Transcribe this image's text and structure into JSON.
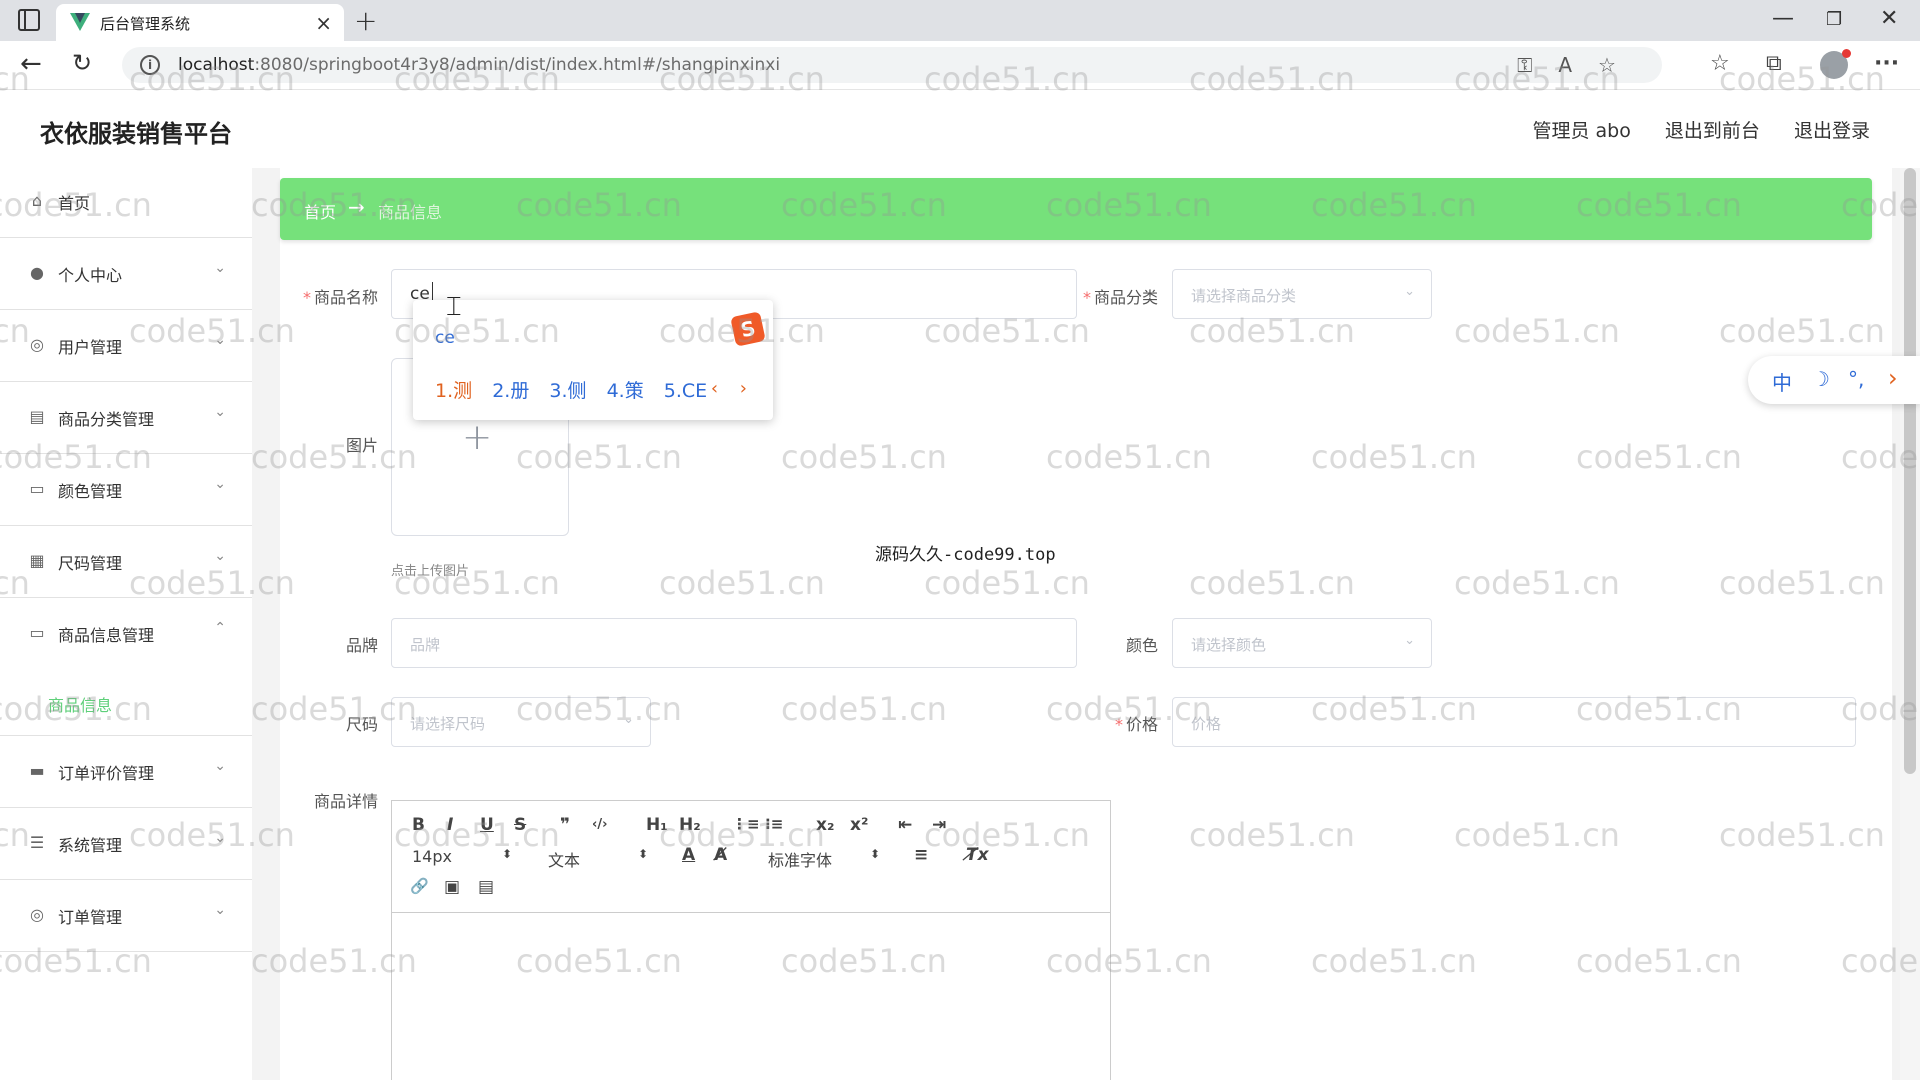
{
  "browser": {
    "tab_title": "后台管理系统",
    "tab_close": "×",
    "new_tab": "+",
    "address_host": "localhost",
    "address_path": ":8080/springboot4r3y8/admin/dist/index.html#/shangpinxinxi",
    "window_controls": [
      "—",
      "❐",
      "✕"
    ]
  },
  "header": {
    "brand": "衣依服装销售平台",
    "user": "管理员 abo",
    "to_front": "退出到前台",
    "logout": "退出登录"
  },
  "sidebar": {
    "items": [
      {
        "label": "首页",
        "icon": "home-icon",
        "glyph": "⌂",
        "arrow": ""
      },
      {
        "label": "个人中心",
        "icon": "user-icon",
        "glyph": "●",
        "arrow": "⌄"
      },
      {
        "label": "用户管理",
        "icon": "compass-icon",
        "glyph": "◎",
        "arrow": "⌄"
      },
      {
        "label": "商品分类管理",
        "icon": "document-icon",
        "glyph": "▤",
        "arrow": "⌄"
      },
      {
        "label": "颜色管理",
        "icon": "chat-icon",
        "glyph": "▭",
        "arrow": "⌄"
      },
      {
        "label": "尺码管理",
        "icon": "printer-icon",
        "glyph": "▦",
        "arrow": "⌄"
      },
      {
        "label": "商品信息管理",
        "icon": "card-icon",
        "glyph": "▭",
        "arrow": "⌃"
      },
      {
        "label": "订单评价管理",
        "icon": "comment-icon",
        "glyph": "▬",
        "arrow": "⌄"
      },
      {
        "label": "系统管理",
        "icon": "list-icon",
        "glyph": "☰",
        "arrow": "⌄"
      },
      {
        "label": "订单管理",
        "icon": "target-icon",
        "glyph": "◎",
        "arrow": "⌄"
      }
    ],
    "active_sub": "商品信息"
  },
  "breadcrumb": {
    "home": "首页",
    "arrow": "→",
    "current": "商品信息"
  },
  "form": {
    "name_label": "商品名称",
    "name_value": "ce",
    "category_label": "商品分类",
    "category_placeholder": "请选择商品分类",
    "image_label": "图片",
    "upload_hint": "点击上传图片",
    "brand_label": "品牌",
    "brand_placeholder": "品牌",
    "color_label": "颜色",
    "color_placeholder": "请选择颜色",
    "size_label": "尺码",
    "size_placeholder": "请选择尺码",
    "price_label": "价格",
    "price_placeholder": "价格",
    "detail_label": "商品详情",
    "required_mark": "*"
  },
  "ime": {
    "input": "ce",
    "candidates": [
      "1.测",
      "2.册",
      "3.侧",
      "4.策",
      "5.CE"
    ],
    "nav": "‹ ›",
    "logo": "S",
    "float_items": [
      "中",
      "☽",
      "°,",
      "›"
    ]
  },
  "editor": {
    "font_size": "14px",
    "paragraph": "文本",
    "font_family": "标准字体",
    "tools_row1": [
      "B",
      "I",
      "U",
      "S",
      "❞",
      "‹/›",
      "H₁",
      "H₂",
      "⋮≡",
      "⁝≡",
      "x₂",
      "x²",
      "⇤",
      "⇥"
    ],
    "tools_row2_extra": [
      "A",
      "A̸",
      "≡",
      "T̸x"
    ],
    "tools_row3": [
      "🔗",
      "▣",
      "▤"
    ]
  },
  "overlay_text": "源码久久-code99.top",
  "watermark": "code51.cn"
}
